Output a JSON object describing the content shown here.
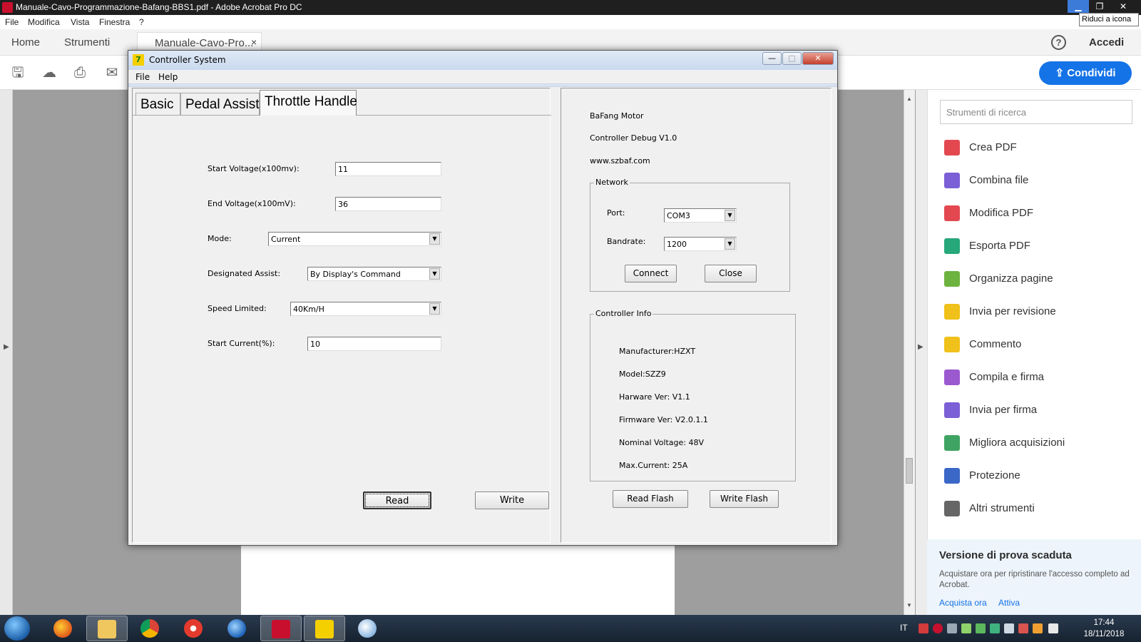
{
  "acrobat": {
    "title": "Manuale-Cavo-Programmazione-Bafang-BBS1.pdf - Adobe Acrobat Pro DC",
    "tooltip": "Riduci a icona",
    "menu": [
      "File",
      "Modifica",
      "Vista",
      "Finestra",
      "?"
    ],
    "tabs": {
      "home": "Home",
      "tools": "Strumenti",
      "document": "Manuale-Cavo-Pro...",
      "close": "×"
    },
    "help": "?",
    "signin": "Accedi",
    "share": "Condividi",
    "tools_pane": {
      "search_placeholder": "Strumenti di ricerca",
      "items": [
        {
          "label": "Crea PDF",
          "color": "#e34850"
        },
        {
          "label": "Combina file",
          "color": "#7b5fd6"
        },
        {
          "label": "Modifica PDF",
          "color": "#e34850"
        },
        {
          "label": "Esporta PDF",
          "color": "#26a87a"
        },
        {
          "label": "Organizza pagine",
          "color": "#6db33f"
        },
        {
          "label": "Invia per revisione",
          "color": "#f0c11a"
        },
        {
          "label": "Commento",
          "color": "#f0c11a"
        },
        {
          "label": "Compila e firma",
          "color": "#9b59d0"
        },
        {
          "label": "Invia per firma",
          "color": "#7b5fd6"
        },
        {
          "label": "Migliora acquisizioni",
          "color": "#3fa463"
        },
        {
          "label": "Protezione",
          "color": "#3b67c7"
        },
        {
          "label": "Altri strumenti",
          "color": "#666666"
        }
      ],
      "trial": {
        "heading": "Versione di prova scaduta",
        "text": "Acquistare ora per ripristinare l'accesso completo ad Acrobat.",
        "buy": "Acquista ora",
        "activate": "Attiva"
      }
    }
  },
  "dialog": {
    "title": "Controller System",
    "menu": [
      "File",
      "Help"
    ],
    "window_buttons": {
      "minimize": "—",
      "maximize": "□",
      "close": "✕"
    },
    "tabs": [
      "Basic",
      "Pedal Assist",
      "Throttle Handle"
    ],
    "active_tab": "Throttle Handle",
    "fields": {
      "start_voltage": {
        "label": "Start Voltage(x100mv):",
        "value": "11"
      },
      "end_voltage": {
        "label": "End Voltage(x100mV):",
        "value": "36"
      },
      "mode": {
        "label": "Mode:",
        "value": "Current"
      },
      "designated_assist": {
        "label": "Designated Assist:",
        "value": "By Display's Command"
      },
      "speed_limited": {
        "label": "Speed Limited:",
        "value": "40Km/H"
      },
      "start_current": {
        "label": "Start Current(%):",
        "value": "10"
      }
    },
    "buttons": {
      "read": "Read",
      "write": "Write"
    },
    "about": {
      "line1": "BaFang Motor",
      "line2": "Controller Debug V1.0",
      "line3": "www.szbaf.com"
    },
    "network": {
      "title": "Network",
      "port_label": "Port:",
      "port_value": "COM3",
      "baud_label": "Bandrate:",
      "baud_value": "1200",
      "connect": "Connect",
      "close": "Close"
    },
    "controller_info": {
      "title": "Controller Info",
      "manufacturer": "Manufacturer:HZXT",
      "model": "Model:SZZ9",
      "hardware": "Harware Ver: V1.1",
      "firmware": "Firmware Ver: V2.0.1.1",
      "voltage": "Nominal Voltage: 48V",
      "current": "Max.Current: 25A"
    },
    "flash": {
      "read": "Read Flash",
      "write": "Write Flash"
    }
  },
  "taskbar": {
    "language": "IT",
    "time": "17:44",
    "date": "18/11/2018"
  }
}
